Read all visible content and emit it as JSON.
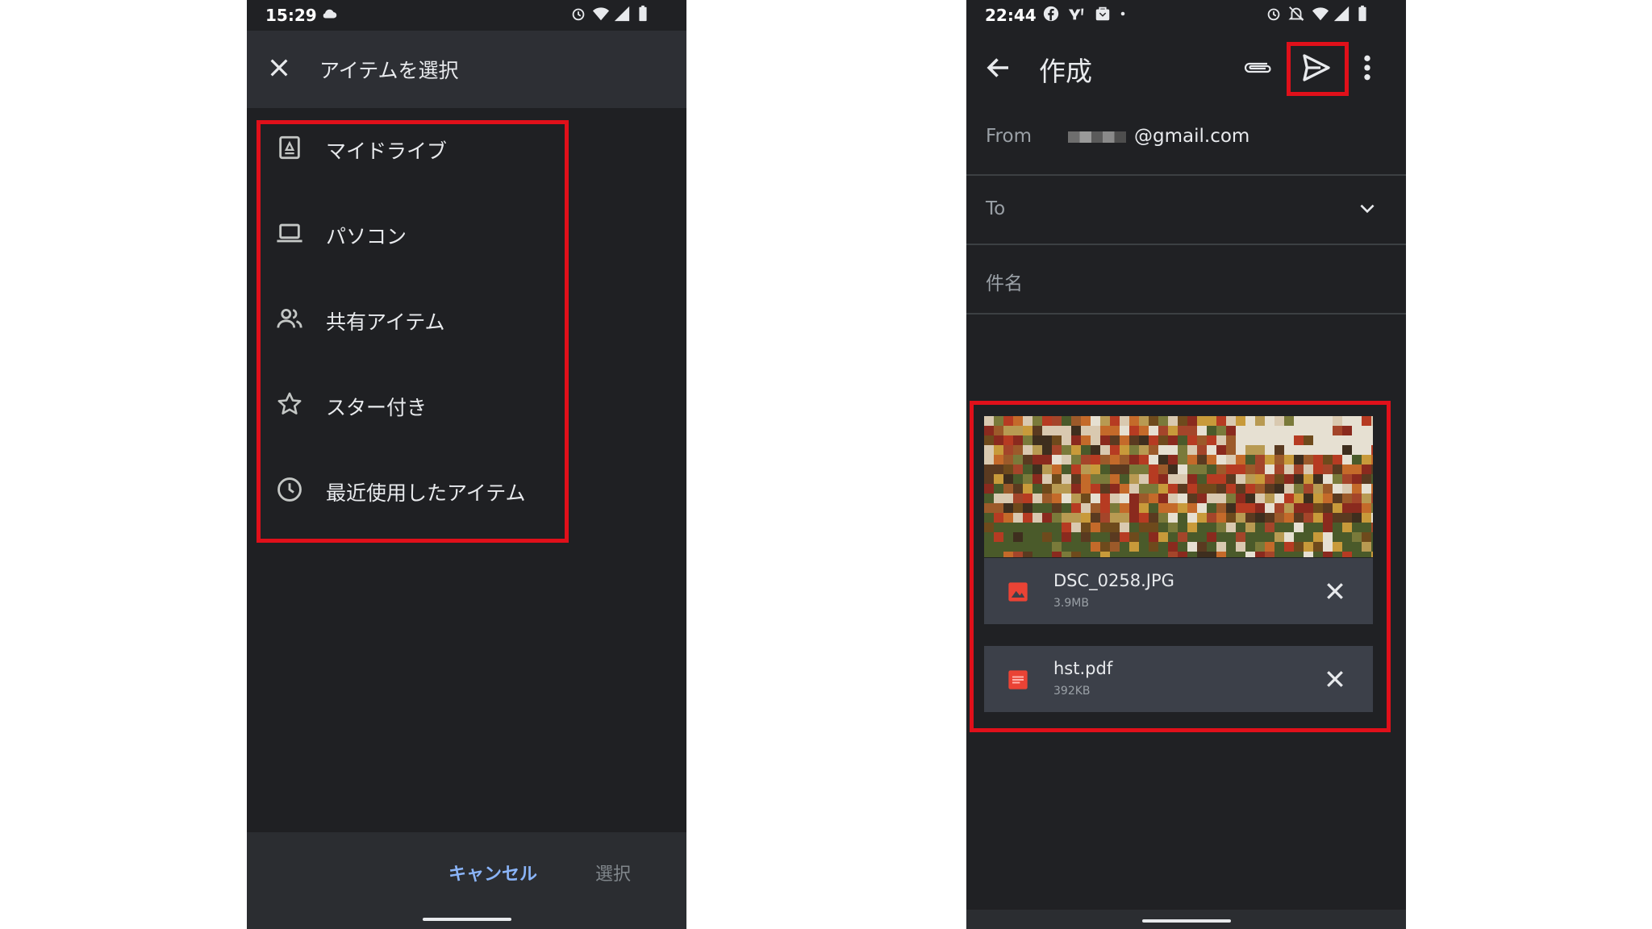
{
  "left_phone": {
    "status": {
      "time": "15:29"
    },
    "header": {
      "title": "アイテムを選択"
    },
    "items": [
      {
        "label": "マイドライブ",
        "icon": "drive-icon"
      },
      {
        "label": "パソコン",
        "icon": "laptop-icon"
      },
      {
        "label": "共有アイテム",
        "icon": "people-icon"
      },
      {
        "label": "スター付き",
        "icon": "star-icon"
      },
      {
        "label": "最近使用したアイテム",
        "icon": "clock-icon"
      }
    ],
    "footer": {
      "cancel_label": "キャンセル",
      "select_label": "選択"
    }
  },
  "right_phone": {
    "status": {
      "time": "22:44"
    },
    "header": {
      "title": "作成"
    },
    "from": {
      "label": "From",
      "value": "@gmail.com"
    },
    "to": {
      "label": "To"
    },
    "subject": {
      "placeholder": "件名"
    },
    "attachments": [
      {
        "name": "DSC_0258.JPG",
        "size": "3.9MB",
        "type": "image"
      },
      {
        "name": "hst.pdf",
        "size": "392KB",
        "type": "pdf"
      }
    ]
  },
  "colors": {
    "highlight": "#e0101a",
    "accent": "#8ab4f8",
    "background": "#202124"
  }
}
